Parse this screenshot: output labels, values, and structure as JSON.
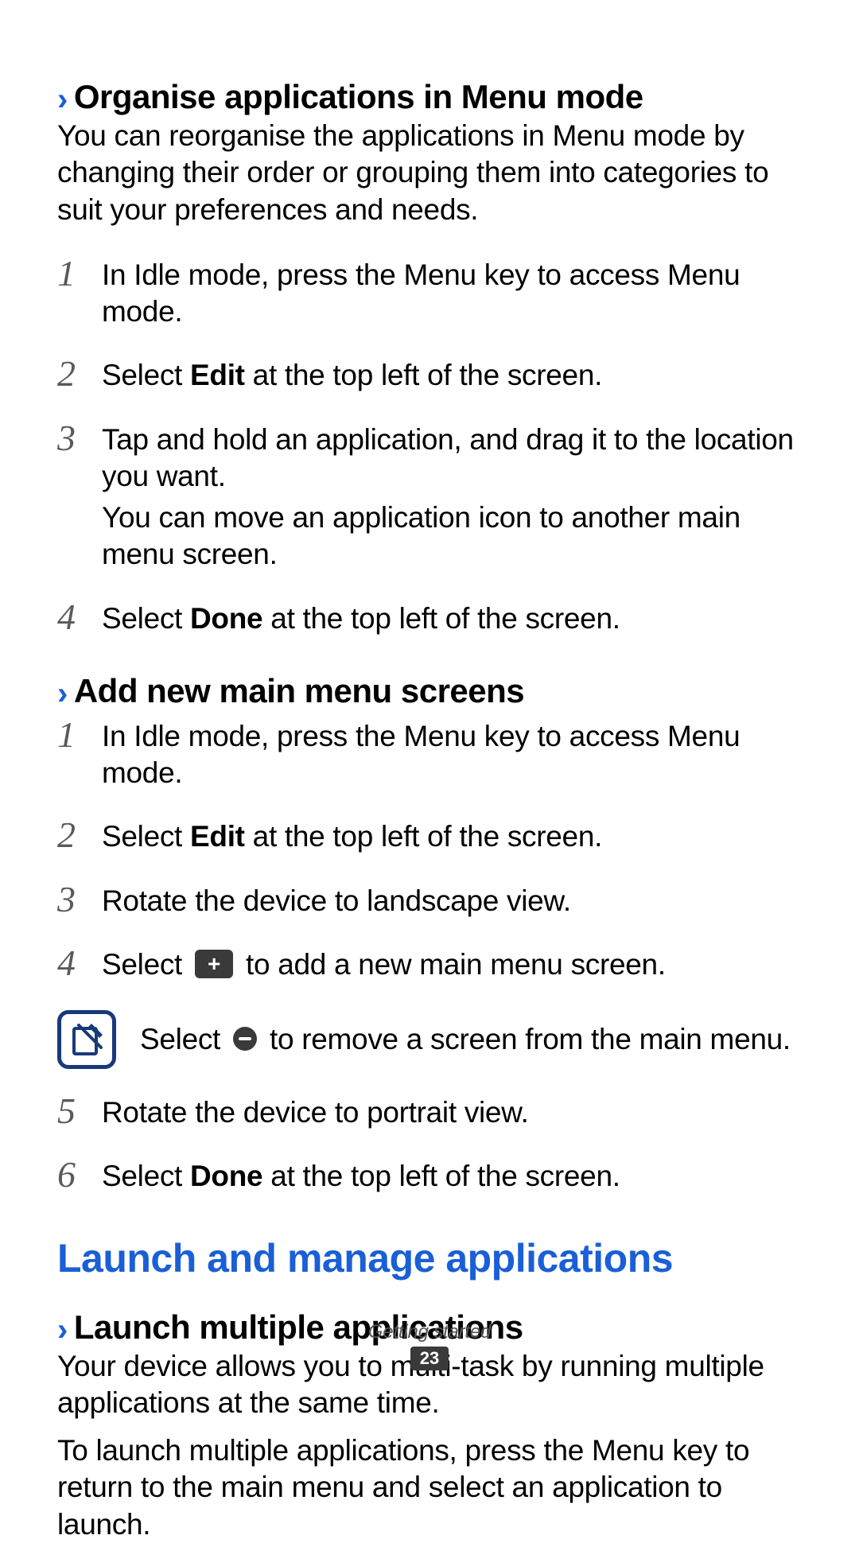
{
  "sections": {
    "organise": {
      "heading": "Organise applications in Menu mode",
      "intro": "You can reorganise the applications in Menu mode by changing their order or grouping them into categories to suit your preferences and needs.",
      "steps": [
        {
          "num": "1",
          "text": "In Idle mode, press the Menu key to access Menu mode."
        },
        {
          "num": "2",
          "before": "Select ",
          "bold": "Edit",
          "after": " at the top left of the screen."
        },
        {
          "num": "3",
          "text": "Tap and hold an application, and drag it to the location you want.",
          "sub": "You can move an application icon to another main menu screen."
        },
        {
          "num": "4",
          "before": "Select ",
          "bold": "Done",
          "after": " at the top left of the screen."
        }
      ]
    },
    "addscreens": {
      "heading": "Add new main menu screens",
      "steps": [
        {
          "num": "1",
          "text": "In Idle mode, press the Menu key to access Menu mode."
        },
        {
          "num": "2",
          "before": "Select ",
          "bold": "Edit",
          "after": " at the top left of the screen."
        },
        {
          "num": "3",
          "text": "Rotate the device to landscape view."
        },
        {
          "num": "4",
          "before": "Select ",
          "after": " to add a new main menu screen."
        }
      ],
      "note": {
        "before": "Select ",
        "after": " to remove a screen from the main menu."
      },
      "steps_after": [
        {
          "num": "5",
          "text": "Rotate the device to portrait view."
        },
        {
          "num": "6",
          "before": "Select ",
          "bold": "Done",
          "after": " at the top left of the screen."
        }
      ]
    },
    "launch": {
      "heading": "Launch and manage applications",
      "sub_heading": "Launch multiple applications",
      "p1": "Your device allows you to multi-task by running multiple applications at the same time.",
      "p2": "To launch multiple applications, press the Menu key to return to the main menu and select an application to launch."
    }
  },
  "footer": {
    "section_label": "Getting started",
    "page_number": "23"
  },
  "icons": {
    "plus_glyph": "+"
  }
}
